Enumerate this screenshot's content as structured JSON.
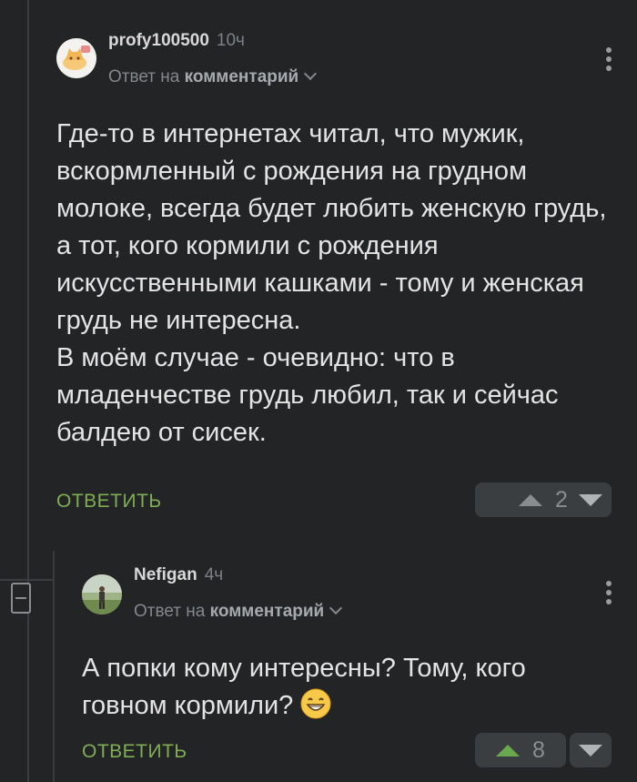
{
  "comments": [
    {
      "username": "profy100500",
      "time": "10ч",
      "reply_prefix": "Ответ на",
      "reply_target": "комментарий",
      "text": "Где-то в интернетах читал, что мужик, вскормленный с рождения на грудном молоке, всегда будет любить женскую грудь, а тот, кого кормили с рождения искусственными кашками - тому и женская грудь не интересна.\nВ моём случае - очевидно: что в младенчестве грудь любил, так и сейчас балдею от сисек.",
      "reply_label": "ОТВЕТИТЬ",
      "score": "2",
      "avatar": "cat-avatar",
      "upvote_color": "#8a8d90"
    },
    {
      "username": "Nefigan",
      "time": "4ч",
      "reply_prefix": "Ответ на",
      "reply_target": "комментарий",
      "text": "А попки кому интересны? Тому, кого говном кормили?",
      "emoji": "grinning-face-emoji",
      "reply_label": "ОТВЕТИТЬ",
      "score": "8",
      "avatar": "person-photo-avatar",
      "upvote_color": "#6aa84f"
    }
  ],
  "colors": {
    "background": "#222426",
    "accent_green": "#7fae53",
    "vote_button_bg": "#3b3e41"
  }
}
